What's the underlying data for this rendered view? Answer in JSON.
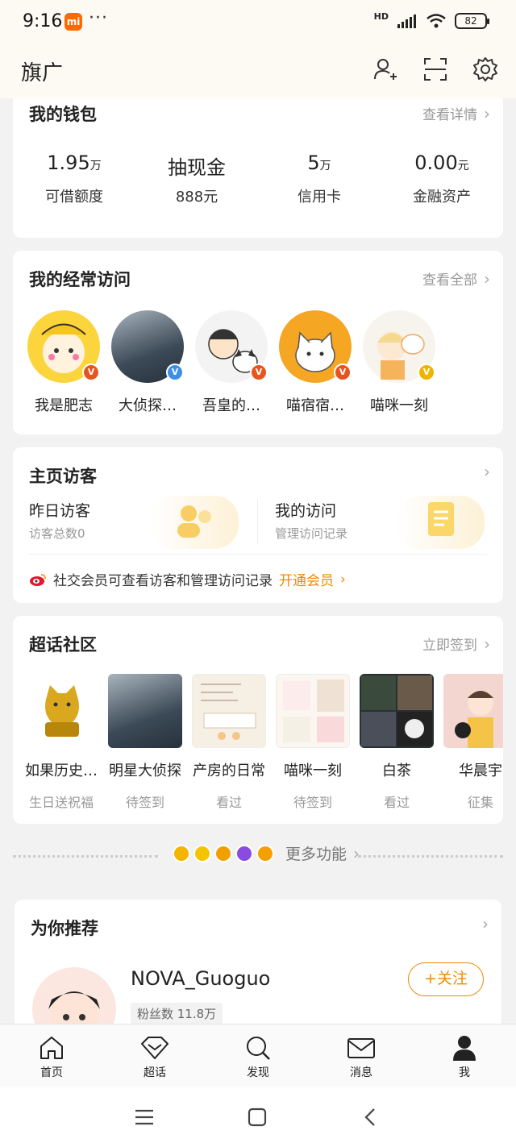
{
  "status": {
    "time": "9:16",
    "battery": "82",
    "network": "HD"
  },
  "header": {
    "title": "旗广"
  },
  "wallet": {
    "title": "我的钱包",
    "more": "查看详情",
    "items": [
      {
        "value": "1.95",
        "unit": "万",
        "label": "可借额度"
      },
      {
        "value": "抽现金",
        "unit": "",
        "label": "888元"
      },
      {
        "value": "5",
        "unit": "万",
        "label": "信用卡"
      },
      {
        "value": "0.00",
        "unit": "元",
        "label": "金融资产"
      }
    ]
  },
  "frequent": {
    "title": "我的经常访问",
    "more": "查看全部",
    "items": [
      {
        "name": "我是肥志",
        "color": "#fcd43c",
        "badge": "#e8541e"
      },
      {
        "name": "大侦探…",
        "color": "#3c4a57",
        "badge": "#3b8fe8"
      },
      {
        "name": "吾皇的…",
        "color": "#f3f3f3",
        "badge": "#e8541e"
      },
      {
        "name": "喵宿宿…",
        "color": "#f5a623",
        "badge": "#e8541e"
      },
      {
        "name": "喵咪一刻",
        "color": "#f7f4ee",
        "badge": "#f0b400"
      }
    ]
  },
  "visitors": {
    "title": "主页访客",
    "yesterday": {
      "title": "昨日访客",
      "sub": "访客总数0"
    },
    "mine": {
      "title": "我的访问",
      "sub": "管理访问记录"
    },
    "notice": "社交会员可查看访客和管理访问记录",
    "open": "开通会员"
  },
  "chaohua": {
    "title": "超话社区",
    "more": "立即签到",
    "items": [
      {
        "name": "如果历史…",
        "status": "生日送祝福",
        "color": "#f7f1dc"
      },
      {
        "name": "明星大侦探",
        "status": "待签到",
        "color": "#3c4a57"
      },
      {
        "name": "产房的日常",
        "status": "看过",
        "color": "#f6efe4"
      },
      {
        "name": "喵咪一刻",
        "status": "待签到",
        "color": "#f4ecec"
      },
      {
        "name": "白茶",
        "status": "看过",
        "color": "#2a2f35"
      },
      {
        "name": "华晨宇",
        "status": "征集",
        "color": "#f3d6cf"
      }
    ]
  },
  "more_features": {
    "label": "更多功能"
  },
  "recommend": {
    "title": "为你推荐",
    "name": "NOVA_Guoguo",
    "fans": "粉丝数 11.8万",
    "follow": "+关注"
  },
  "nav": {
    "items": [
      {
        "label": "首页"
      },
      {
        "label": "超话"
      },
      {
        "label": "发现"
      },
      {
        "label": "消息"
      },
      {
        "label": "我"
      }
    ]
  }
}
